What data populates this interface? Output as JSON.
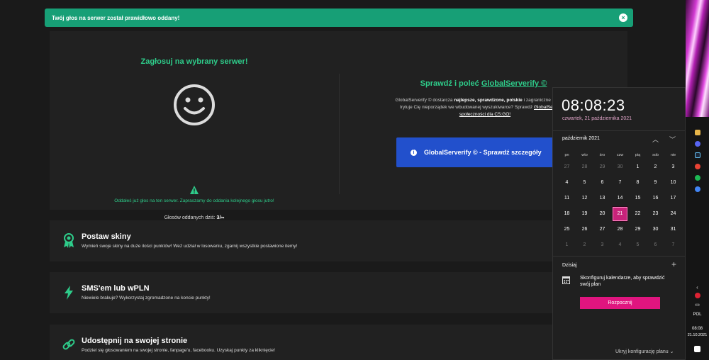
{
  "toast": {
    "message": "Twój głos na serwer został prawidłowo oddany!"
  },
  "vote": {
    "title": "Zagłosuj na wybrany serwer!",
    "message": "Oddałeś już głos na ten serwer. Zapraszamy do oddania kolejnego głosu jutro!",
    "count_label": "Głosów oddanych dziś:",
    "count_value": "3/∞"
  },
  "globalserverify": {
    "title_prefix": "Sprawdź i poleć",
    "title_link": "GlobalServerify ©",
    "desc_line1_a": "GlobalServerify © dostarcza",
    "desc_line1_bold": "najlepsze, sprawdzone, polskie",
    "desc_line1_b": "i zagraniczne serwery be",
    "desc_line2_a": "Irytuje Cię nieporządek we wbudowanej wyszukiwarce? Sprawdź",
    "desc_line2_link": "GlobalServerify ©",
    "desc_line3": "społeczności dla CS:GO!",
    "button_label": "GlobalServerify © - Sprawdź szczegóły"
  },
  "features": [
    {
      "title": "Postaw skiny",
      "desc": "Wymień swoje skiny na duże ilości punktów! Weź udział w losowaniu, zgarnij wszystkie postawione itemy!",
      "icon": "award-icon"
    },
    {
      "title": "SMS'em lub wPLN",
      "desc": "Niewiele brakuje? Wykorzystaj zgromadzone na koncie punkty!",
      "icon": "lightning-icon"
    },
    {
      "title": "Udostępnij na swojej stronie",
      "desc": "Podziel się głosowaniem na swojej stronie, fanpage'u, facebooku. Uzyskaj punkty za kliknięcie!",
      "icon": "link-icon"
    }
  ],
  "calendar": {
    "time": "08:08:23",
    "date": "czwartek, 21 października 2021",
    "month": "październik 2021",
    "weekdays": [
      "pn",
      "wto",
      "śro",
      "czw",
      "pią",
      "sob",
      "nie"
    ],
    "days": [
      [
        "27",
        "28",
        "29",
        "30",
        "1",
        "2",
        "3"
      ],
      [
        "4",
        "5",
        "6",
        "7",
        "8",
        "9",
        "10"
      ],
      [
        "11",
        "12",
        "13",
        "14",
        "15",
        "16",
        "17"
      ],
      [
        "18",
        "19",
        "20",
        "21",
        "22",
        "23",
        "24"
      ],
      [
        "25",
        "26",
        "27",
        "28",
        "29",
        "30",
        "31"
      ],
      [
        "1",
        "2",
        "3",
        "4",
        "5",
        "6",
        "7"
      ]
    ],
    "today_label": "Dzisiaj",
    "note": "Skonfiguruj kalendarze, aby sprawdzić swój plan",
    "start_button": "Rozpocznij",
    "hide_label": "Ukryj konfigurację planu"
  },
  "taskbar": {
    "language": "POL",
    "clock_time": "08:08",
    "clock_date": "21.10.2021"
  },
  "colors": {
    "accent_green": "#2ecc8a",
    "toast_green": "#179f76",
    "button_blue": "#2250cc",
    "today_pink": "#c8237a",
    "start_pink": "#e0157f"
  }
}
